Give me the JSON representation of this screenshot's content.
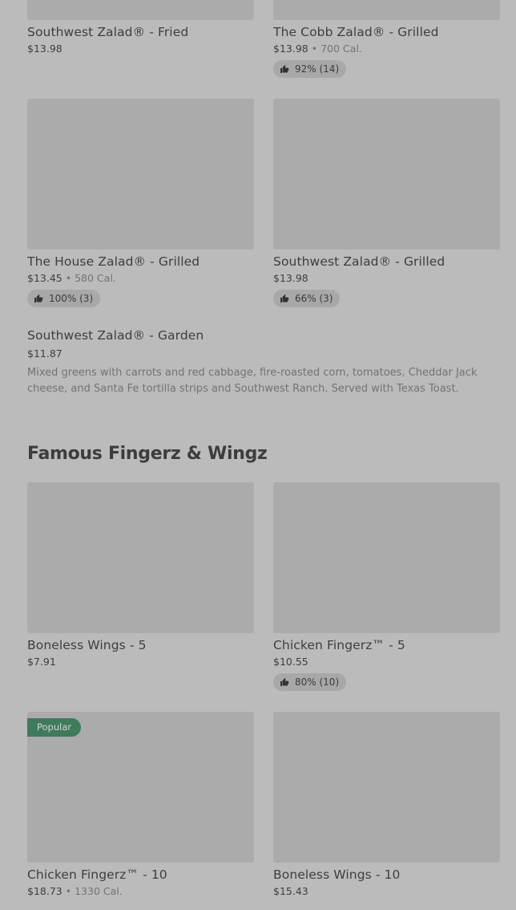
{
  "items_top": [
    {
      "name": "Southwest Zalad® - Fried",
      "price": "$13.98"
    },
    {
      "name": "The Cobb Zalad® - Grilled",
      "price": "$13.98",
      "calories": "700 Cal.",
      "rating": "92% (14)"
    },
    {
      "name": "The House Zalad® - Grilled",
      "price": "$13.45",
      "calories": "580 Cal.",
      "rating": "100% (3)"
    },
    {
      "name": "Southwest Zalad® - Grilled",
      "price": "$13.98",
      "rating": "66% (3)"
    }
  ],
  "garden_item": {
    "name": "Southwest Zalad® - Garden",
    "price": "$11.87",
    "description": "Mixed greens with carrots and red cabbage, fire-roasted corn, tomatoes, Cheddar Jack cheese, and Santa Fe tortilla strips and Southwest Ranch. Served with Texas Toast."
  },
  "section": {
    "title": "Famous Fingerz & Wingz",
    "items": [
      {
        "name": "Boneless Wings - 5",
        "price": "$7.91"
      },
      {
        "name": "Chicken Fingerz™ - 5",
        "price": "$10.55",
        "rating": "80% (10)"
      },
      {
        "name": "Chicken Fingerz™ - 10",
        "price": "$18.73",
        "calories": "1330 Cal.",
        "badge": "Popular"
      },
      {
        "name": "Boneless Wings - 10",
        "price": "$15.43"
      }
    ]
  },
  "separator": "•",
  "icons": {
    "rating": "thumbs-up-icon"
  },
  "colors": {
    "badge": "#3f7a5a",
    "overlay_bg": "#bbbbbb"
  }
}
